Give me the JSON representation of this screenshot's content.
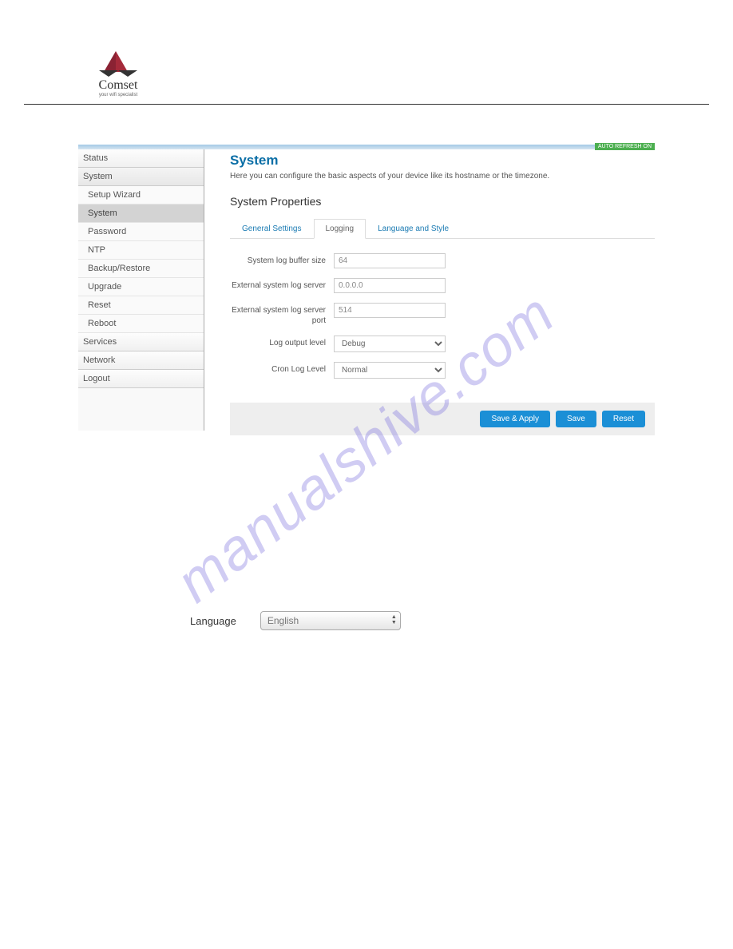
{
  "brand": {
    "name": "Comset",
    "tagline": "your wifi specialist"
  },
  "auto_refresh": "AUTO REFRESH ON",
  "sidebar": {
    "status": "Status",
    "system": "System",
    "system_items": [
      "Setup Wizard",
      "System",
      "Password",
      "NTP",
      "Backup/Restore",
      "Upgrade",
      "Reset",
      "Reboot"
    ],
    "services": "Services",
    "network": "Network",
    "logout": "Logout"
  },
  "main": {
    "title": "System",
    "subtitle": "Here you can configure the basic aspects of your device like its hostname or the timezone.",
    "section_title": "System Properties",
    "tabs": {
      "general": "General Settings",
      "logging": "Logging",
      "language": "Language and Style"
    },
    "form": {
      "buffer_label": "System log buffer size",
      "buffer_value": "64",
      "server_label": "External system log server",
      "server_value": "0.0.0.0",
      "port_label": "External system log server port",
      "port_value": "514",
      "output_label": "Log output level",
      "output_value": "Debug",
      "cron_label": "Cron Log Level",
      "cron_value": "Normal"
    },
    "buttons": {
      "save_apply": "Save & Apply",
      "save": "Save",
      "reset": "Reset"
    }
  },
  "language_control": {
    "label": "Language",
    "value": "English"
  },
  "watermark": "manualshive.com"
}
